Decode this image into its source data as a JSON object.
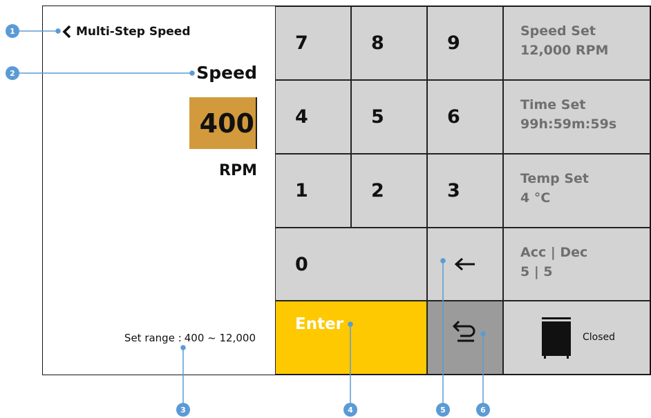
{
  "header": {
    "title": "Multi-Step Speed"
  },
  "input": {
    "label": "Speed",
    "value": "400",
    "unit": "RPM",
    "range_label": "Set range :",
    "range_value": "400 ~ 12,000"
  },
  "keypad": {
    "keys": [
      "7",
      "8",
      "9",
      "4",
      "5",
      "6",
      "1",
      "2",
      "3",
      "0"
    ],
    "enter_label": "Enter",
    "backspace_icon": "left-arrow-icon",
    "undo_icon": "undo-arrow-icon"
  },
  "status": [
    {
      "label": "Speed Set",
      "value": "12,000 RPM"
    },
    {
      "label": "Time Set",
      "value": "99h:59m:59s"
    },
    {
      "label": "Temp Set",
      "value": "4 °C"
    },
    {
      "label": "Acc | Dec",
      "value": "5 | 5"
    }
  ],
  "door": {
    "label": "Closed",
    "icon": "door-closed-icon"
  },
  "callouts": [
    "1",
    "2",
    "3",
    "4",
    "5",
    "6"
  ],
  "colors": {
    "value_highlight": "#d29a3c",
    "enter_key": "#fec900",
    "undo_key": "#9b9b9b",
    "key_gray": "#d3d3d3",
    "callout_blue": "#5b9bd5"
  }
}
